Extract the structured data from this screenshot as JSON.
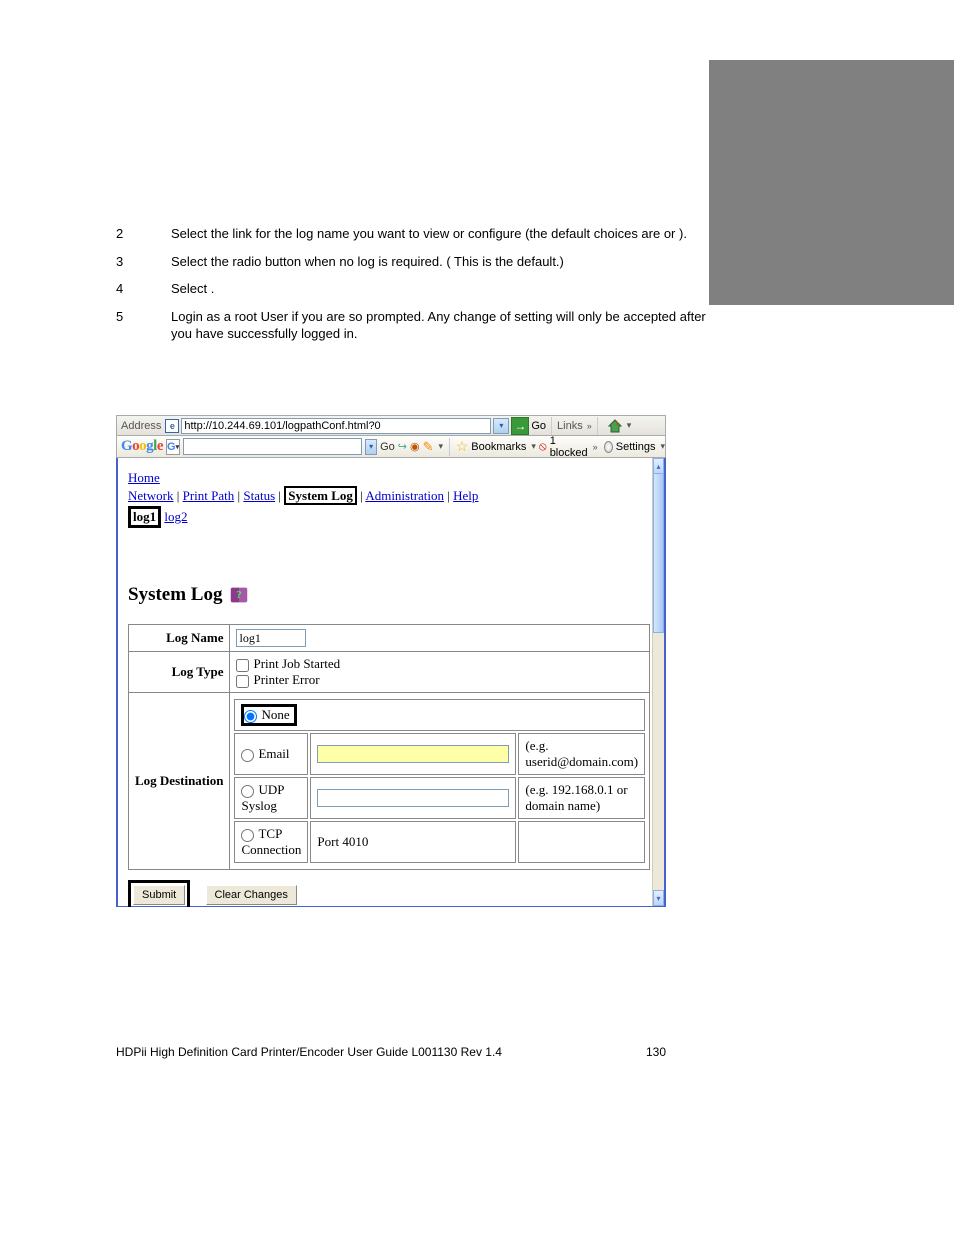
{
  "instructions": [
    {
      "num": "2",
      "text": "Select the link for the log name you want to view or configure (the default choices are        or        )."
    },
    {
      "num": "3",
      "text": "Select the         radio button when no log is required. (         This is the default.)"
    },
    {
      "num": "4",
      "text": "Select            ."
    },
    {
      "num": "5",
      "text": "Login as a root User if you are so prompted. Any change of setting will only be accepted after you have successfully logged in."
    }
  ],
  "address_bar": {
    "label": "Address",
    "url": "http://10.244.69.101/logpathConf.html?0",
    "go": "Go",
    "links": "Links"
  },
  "google_bar": {
    "go": "Go",
    "bookmarks": "Bookmarks",
    "blocked": "1 blocked",
    "settings": "Settings"
  },
  "nav": {
    "home": "Home",
    "network": "Network",
    "print_path": "Print Path",
    "status": "Status",
    "system_log": "System Log",
    "administration": "Administration",
    "help": "Help",
    "log1": "log1",
    "log2": "log2"
  },
  "section_title": "System Log",
  "form": {
    "log_name_label": "Log Name",
    "log_name_value": "log1",
    "log_type_label": "Log Type",
    "print_job_started": "Print Job Started",
    "printer_error": "Printer Error",
    "log_dest_label": "Log Destination",
    "none": "None",
    "email": "Email",
    "email_hint": "(e.g. userid@domain.com)",
    "udp": "UDP Syslog",
    "udp_hint": "(e.g. 192.168.0.1 or domain name)",
    "tcp": "TCP Connection",
    "port": "Port 4010",
    "submit": "Submit",
    "clear": "Clear Changes"
  },
  "footer": {
    "left": "HDPii High Definition Card Printer/Encoder User Guide    L001130 Rev 1.4",
    "page": "130"
  }
}
